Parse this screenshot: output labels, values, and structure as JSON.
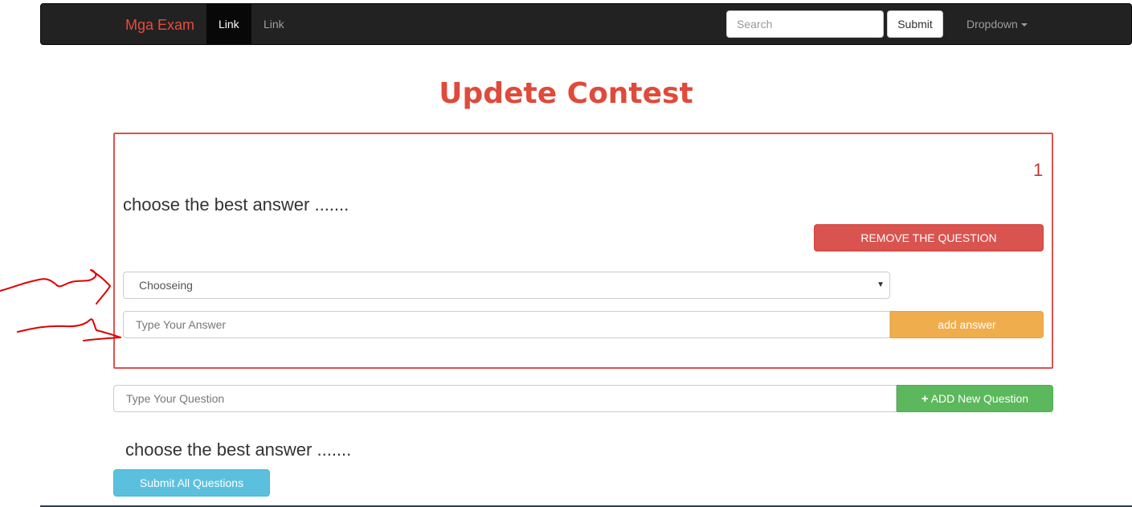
{
  "navbar": {
    "brand": "Mga Exam",
    "links": [
      "Link",
      "Link"
    ],
    "search_placeholder": "Search",
    "submit_label": "Submit",
    "dropdown_label": "Dropdown"
  },
  "page": {
    "title": "Updete Contest"
  },
  "question_card": {
    "number": "1",
    "question_text": "choose the best answer .......",
    "remove_label": "REMOVE THE QUESTION",
    "select_value": "Chooseing",
    "answer_placeholder": "Type Your Answer",
    "add_answer_label": "add answer"
  },
  "new_question": {
    "placeholder": "Type Your Question",
    "add_label": "ADD New Question"
  },
  "footer": {
    "question_text": "choose the best answer .......",
    "submit_all_label": "Submit All Questions"
  },
  "colors": {
    "title": "#e04a3b",
    "danger": "#d9534f",
    "warning": "#f0ad4e",
    "success": "#5cb85c",
    "info": "#5bc0de",
    "navbar_bg": "#222222",
    "annotation": "#e00000"
  }
}
